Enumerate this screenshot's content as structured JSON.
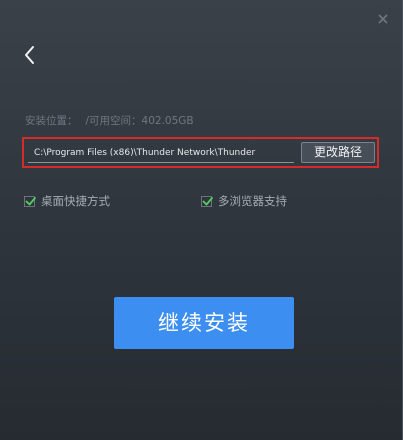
{
  "window": {
    "close_icon": "close-icon",
    "back_icon": "chevron-left-icon"
  },
  "install_location": {
    "label": "安装位置：",
    "space_label": "/可用空间：402.05GB"
  },
  "path": {
    "value": "C:\\Program Files (x86)\\Thunder Network\\Thunder",
    "change_button_label": "更改路径"
  },
  "options": {
    "desktop_shortcut": {
      "label": "桌面快捷方式",
      "checked": true
    },
    "multi_browser": {
      "label": "多浏览器支持",
      "checked": true
    }
  },
  "actions": {
    "continue_install_label": "继续安装"
  },
  "colors": {
    "accent": "#3d8ef1",
    "highlight_border": "#d62b2b",
    "checkmark": "#4fd15a"
  }
}
